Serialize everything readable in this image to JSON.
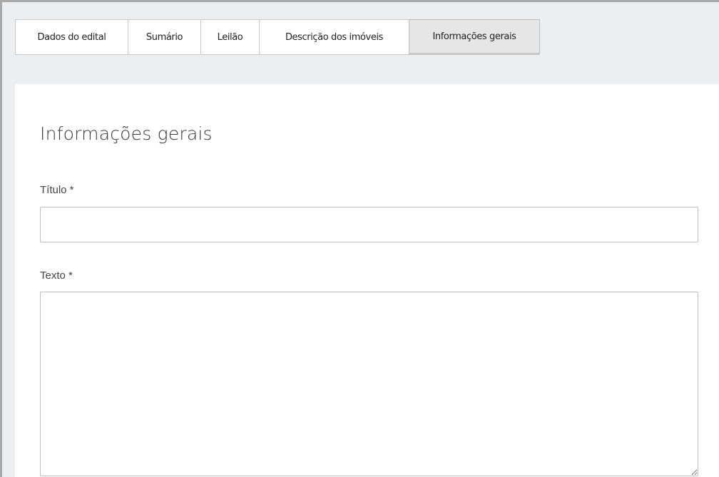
{
  "tabs": [
    {
      "label": "Dados do edital",
      "active": false
    },
    {
      "label": "Sumário",
      "active": false
    },
    {
      "label": "Leilão",
      "active": false
    },
    {
      "label": "Descrição dos imóveis",
      "active": false
    },
    {
      "label": "Informações gerais",
      "active": true
    }
  ],
  "section": {
    "title": "Informações gerais"
  },
  "form": {
    "titulo_label": "Título *",
    "titulo_value": "",
    "texto_label": "Texto *",
    "texto_value": ""
  },
  "colors": {
    "page_background": "#eceff2",
    "active_tab_background": "#e6e6e6",
    "field_border": "#bfbfbf"
  }
}
